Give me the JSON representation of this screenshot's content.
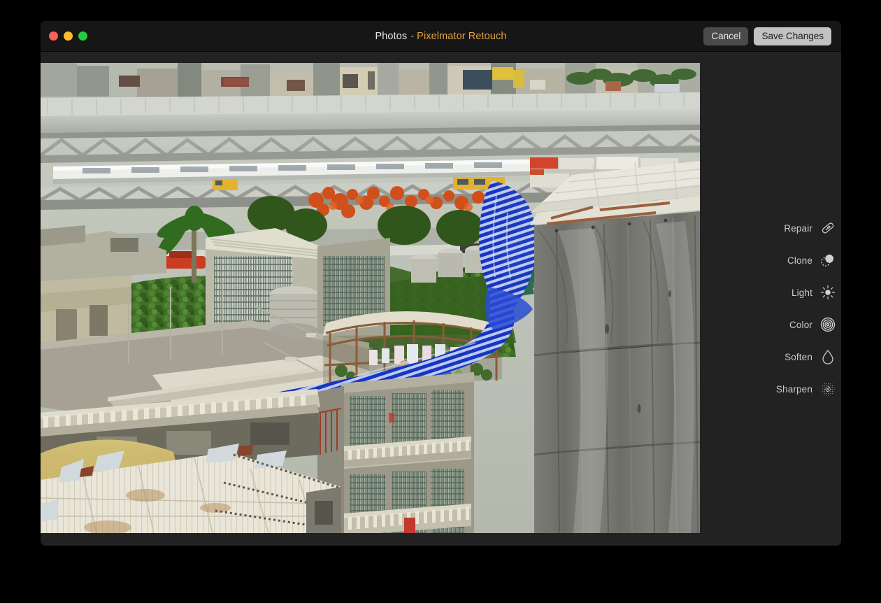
{
  "window": {
    "traffic_lights": [
      {
        "name": "close",
        "color": "#ff5f57"
      },
      {
        "name": "minimize",
        "color": "#febc2e"
      },
      {
        "name": "maximize",
        "color": "#28c840"
      }
    ],
    "title": {
      "app": "Photos",
      "separator": "-",
      "document": "Pixelmator Retouch",
      "app_color": "#e6e6e6",
      "document_color": "#e8a33d"
    },
    "background_color": "#222222",
    "titlebar_color": "#161616"
  },
  "toolbar": {
    "cancel_label": "Cancel",
    "save_label": "Save Changes",
    "cancel_bg": "#4a4a4a",
    "save_bg": "#c2c2c2"
  },
  "tools": {
    "items": [
      {
        "label": "Repair",
        "icon": "bandage-icon"
      },
      {
        "label": "Clone",
        "icon": "clone-stamp-icon"
      },
      {
        "label": "Light",
        "icon": "sun-icon"
      },
      {
        "label": "Color",
        "icon": "concentric-circles-icon"
      },
      {
        "label": "Soften",
        "icon": "droplet-icon"
      },
      {
        "label": "Sharpen",
        "icon": "stipple-circle-icon"
      }
    ],
    "label_color": "#c9c9c9"
  },
  "photo": {
    "description": "Aerial cityscape view of dense urban rooftops with an elevated highway overpass in the background, tropical trees, water tanks, a blue-and-white striped tarp hanging from a rooftop, balconied apartment buildings, and a large building wrapped in gray construction netting on the right",
    "palette": {
      "sky_haze": "#c9ccc2",
      "highway_concrete": "#b9bcb4",
      "foliage_green": "#3c6b21",
      "flamboyant_orange": "#d84a1a",
      "rooftop_concrete": "#a9a396",
      "white_roof": "#efeade",
      "blue_tarp": "#1333c8",
      "gray_netting": "#73736e",
      "balustrade_white": "#d8d6cc",
      "tan_dome": "#c8b46a"
    }
  }
}
